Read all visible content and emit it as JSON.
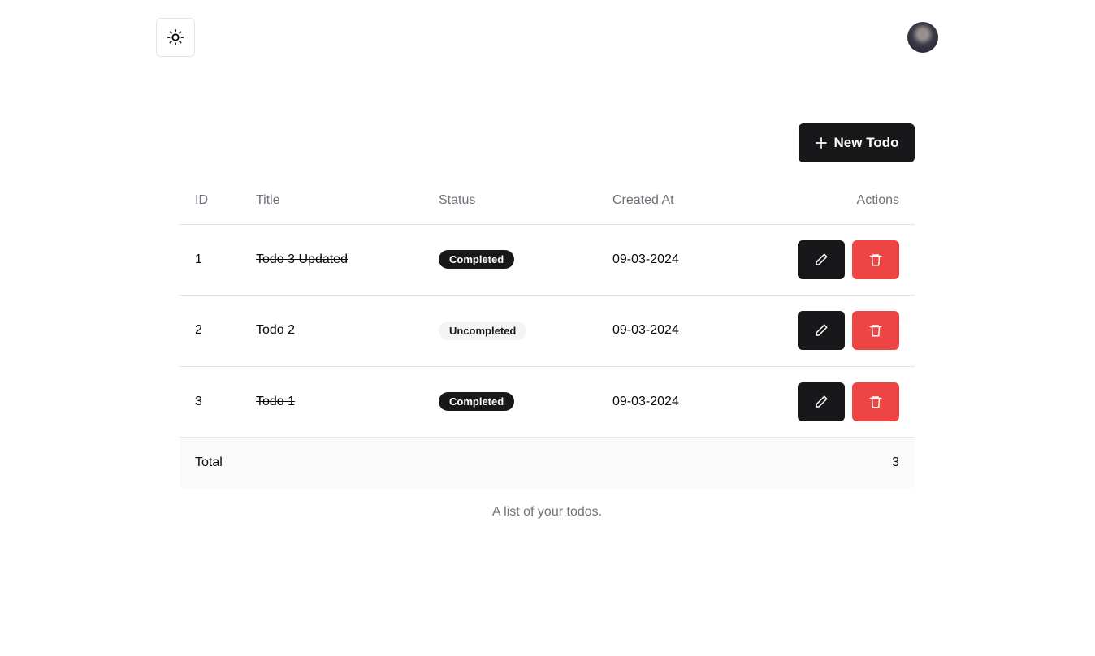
{
  "header": {
    "theme_icon": "sun-icon",
    "avatar_alt": "user avatar"
  },
  "toolbar": {
    "new_label": "New Todo",
    "new_icon": "plus-icon"
  },
  "table": {
    "columns": [
      "ID",
      "Title",
      "Status",
      "Created At",
      "Actions"
    ],
    "rows": [
      {
        "id": "1",
        "title": "Todo 3 Updated",
        "status": "Completed",
        "created": "09-03-2024",
        "done": true
      },
      {
        "id": "2",
        "title": "Todo 2",
        "status": "Uncompleted",
        "created": "09-03-2024",
        "done": false
      },
      {
        "id": "3",
        "title": "Todo 1",
        "status": "Completed",
        "created": "09-03-2024",
        "done": true
      }
    ],
    "footer": {
      "label": "Total",
      "value": "3"
    },
    "caption": "A list of your todos."
  },
  "colors": {
    "primary": "#18181b",
    "danger": "#ef4444"
  }
}
